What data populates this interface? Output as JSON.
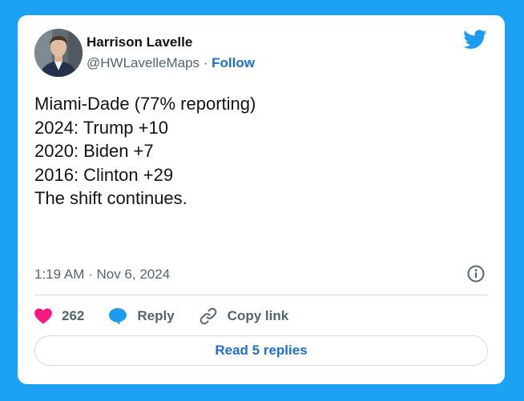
{
  "author": {
    "name": "Harrison Lavelle",
    "handle": "@HWLavelleMaps",
    "separator": " · ",
    "follow_label": "Follow"
  },
  "tweet": {
    "lines": [
      "Miami-Dade (77% reporting)",
      "",
      "2024: Trump +10",
      "2020: Biden +7",
      "2016: Clinton +29",
      "",
      "The shift continues."
    ],
    "timestamp": "1:19 AM · Nov 6, 2024"
  },
  "actions": {
    "like_count": "262",
    "reply_label": "Reply",
    "copy_link_label": "Copy link"
  },
  "read_replies_label": "Read 5 replies",
  "colors": {
    "background": "#1da1f2",
    "like": "#f91880",
    "reply": "#1d9bf0",
    "link": "#1d70c8",
    "text_muted": "#536471"
  },
  "icons": {
    "brand": "twitter-bird-icon",
    "info": "info-icon",
    "like": "heart-icon",
    "reply": "speech-bubble-icon",
    "copy_link": "link-icon"
  }
}
